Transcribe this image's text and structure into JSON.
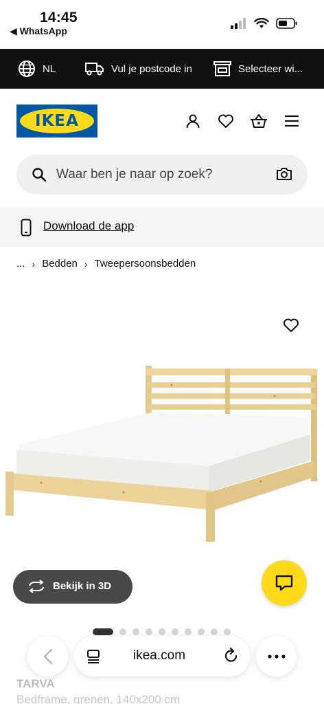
{
  "status_bar": {
    "time": "14:45",
    "back_app": "◀ WhatsApp"
  },
  "top_strip": {
    "language": "NL",
    "postcode": "Vul je postcode in",
    "store": "Selecteer wi..."
  },
  "header": {
    "logo_text": "IKEA",
    "icons": [
      "user-icon",
      "heart-icon",
      "basket-icon",
      "menu-icon"
    ]
  },
  "search": {
    "placeholder": "Waar ben je naar op zoek?"
  },
  "download_app": {
    "label": "Download de app"
  },
  "breadcrumb": {
    "ellipsis": "...",
    "items": [
      "Bedden",
      "Tweepersoonsbedden"
    ]
  },
  "product": {
    "view3d_label": "Bekijk in 3D",
    "name": "TARVA",
    "description": "Bedframe, grenen, 140x200 cm",
    "image_count": 10,
    "active_image": 1
  },
  "browser": {
    "url": "ikea.com"
  },
  "colors": {
    "ikea_blue": "#0058a3",
    "ikea_yellow": "#ffda1a",
    "strip_bg": "#111111"
  }
}
